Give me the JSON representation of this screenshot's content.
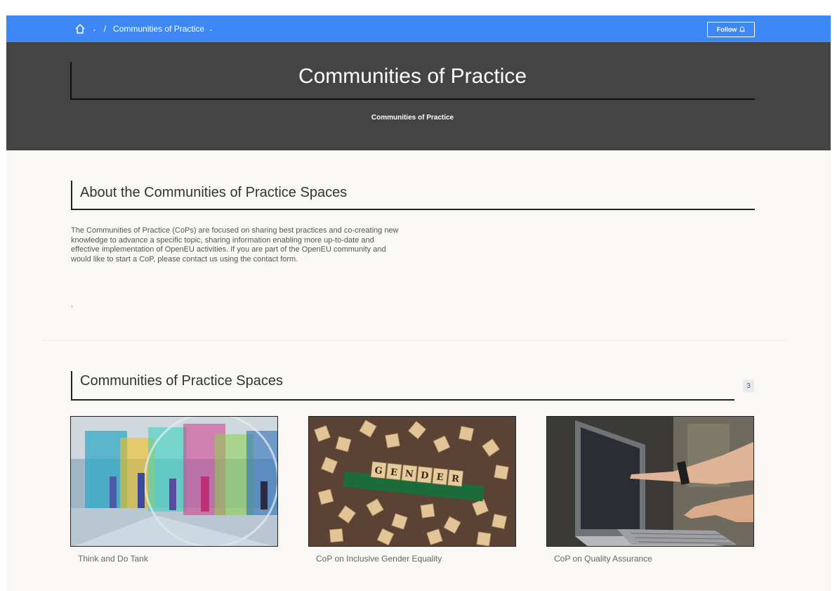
{
  "breadcrumb": {
    "home_icon": "home-icon",
    "current": "Communities of Practice"
  },
  "follow": {
    "label": "Follow",
    "icon": "bell-icon"
  },
  "hero": {
    "title": "Communities of Practice",
    "subtitle": "Communities of Practice"
  },
  "about": {
    "heading": "About the Communities of Practice Spaces",
    "body": "The Communities of Practice (CoPs) are focused on sharing best practices and co-creating new knowledge to advance a specific topic, sharing information enabling more up-to-date and effective implementation of OpenEU activities. If you are part of the OpenEU community and would like to start a CoP, please contact us using the contact form.",
    "trailing": "."
  },
  "spaces": {
    "heading": "Communities of Practice Spaces",
    "count": "3",
    "cards": [
      {
        "label": "Think and Do Tank",
        "image": "colorful-glass-atrium-photo"
      },
      {
        "label": "CoP on Inclusive Gender Equality",
        "image": "scrabble-gender-tiles-photo"
      },
      {
        "label": "CoP on Quality Assurance",
        "image": "hands-pointing-laptop-photo"
      }
    ]
  },
  "colors": {
    "topbar": "#3d88f5",
    "hero": "#444444",
    "page_bg": "#f9f8f5"
  }
}
